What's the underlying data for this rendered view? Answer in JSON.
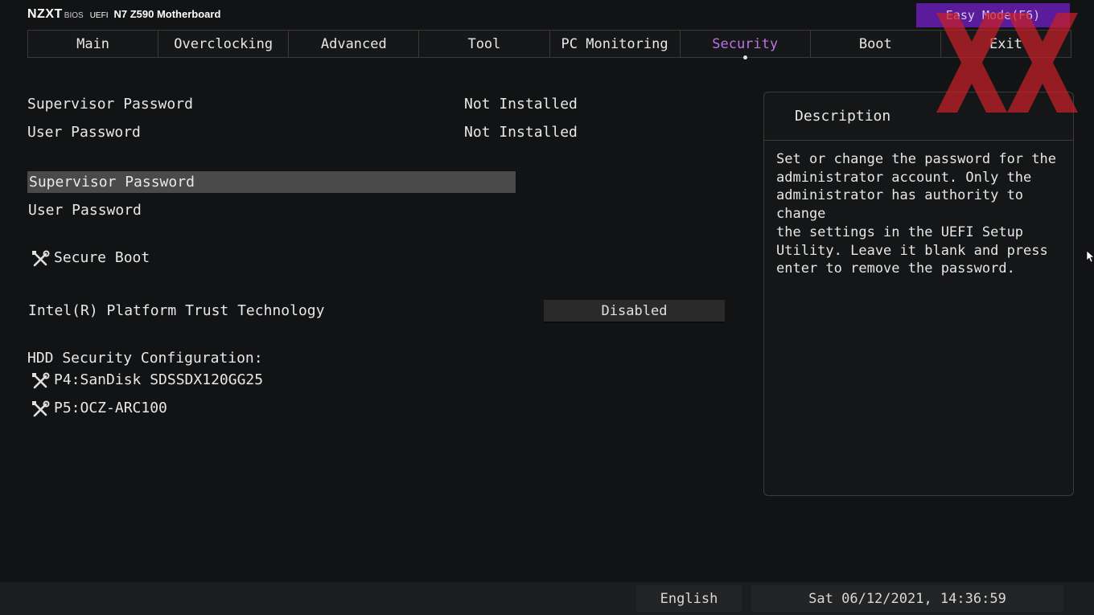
{
  "header": {
    "brand_logo": "NZXT",
    "brand_bios": "BIOS",
    "brand_uefi": "UEFI",
    "board_name": "N7 Z590 Motherboard",
    "easy_mode_label": "Easy Mode(F6)"
  },
  "tabs": [
    {
      "label": "Main",
      "active": false
    },
    {
      "label": "Overclocking",
      "active": false
    },
    {
      "label": "Advanced",
      "active": false
    },
    {
      "label": "Tool",
      "active": false
    },
    {
      "label": "PC Monitoring",
      "active": false
    },
    {
      "label": "Security",
      "active": true
    },
    {
      "label": "Boot",
      "active": false
    },
    {
      "label": "Exit",
      "active": false
    }
  ],
  "status": {
    "supervisor_password_label": "Supervisor Password",
    "supervisor_password_value": "Not Installed",
    "user_password_label": "User Password",
    "user_password_value": "Not Installed"
  },
  "items": {
    "supervisor_password": "Supervisor Password",
    "user_password": "User Password",
    "secure_boot": "Secure Boot",
    "ptt_label": "Intel(R) Platform Trust Technology",
    "ptt_value": "Disabled",
    "hdd_header": "HDD Security Configuration:",
    "hdd_p4": "P4:SanDisk SDSSDX120GG25",
    "hdd_p5": "P5:OCZ-ARC100"
  },
  "description": {
    "title": "Description",
    "text": "Set or change the password for the\nadministrator account. Only the\nadministrator has authority to change\nthe settings in the UEFI Setup\nUtility. Leave it blank and press\nenter to remove the password."
  },
  "footer": {
    "language": "English",
    "datetime": "Sat 06/12/2021, 14:36:59"
  },
  "colors": {
    "accent": "#b874e8",
    "easy_mode_bg": "#5a1c9a",
    "watermark": "#c8202a",
    "selected_row_bg": "#4a4a4a",
    "background": "#121314"
  },
  "icons": {
    "tool": "wrench-screwdriver-icon"
  }
}
